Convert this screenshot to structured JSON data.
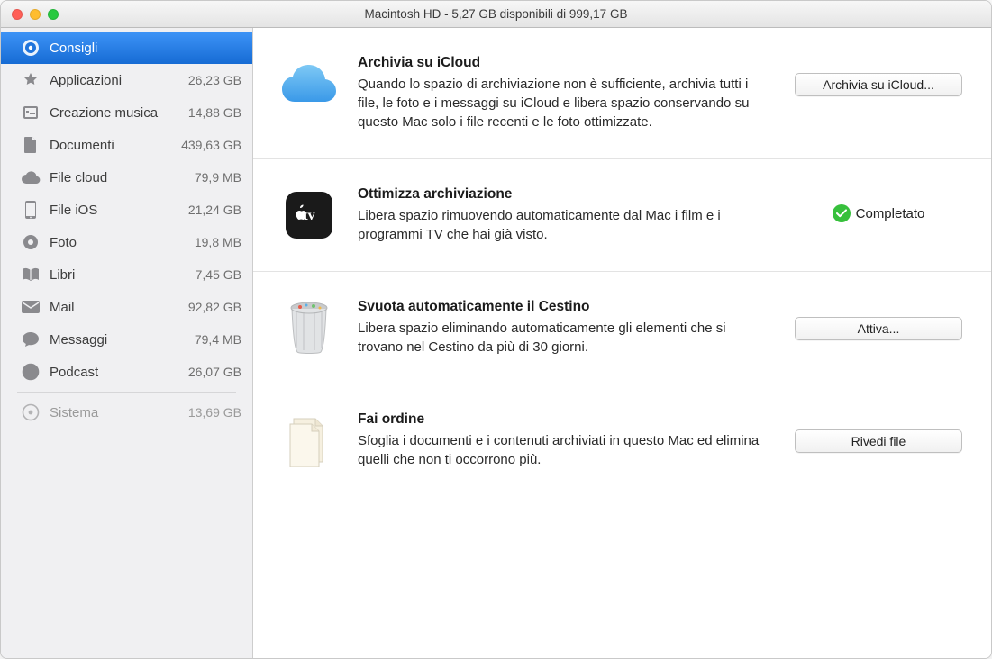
{
  "window": {
    "title": "Macintosh HD - 5,27 GB disponibili di 999,17 GB"
  },
  "sidebar": {
    "items": [
      {
        "label": "Consigli",
        "size": "",
        "icon": "tips"
      },
      {
        "label": "Applicazioni",
        "size": "26,23 GB",
        "icon": "apps"
      },
      {
        "label": "Creazione musica",
        "size": "14,88 GB",
        "icon": "music-creation"
      },
      {
        "label": "Documenti",
        "size": "439,63 GB",
        "icon": "documents"
      },
      {
        "label": "File cloud",
        "size": "79,9 MB",
        "icon": "cloud"
      },
      {
        "label": "File iOS",
        "size": "21,24 GB",
        "icon": "ios"
      },
      {
        "label": "Foto",
        "size": "19,8 MB",
        "icon": "photos"
      },
      {
        "label": "Libri",
        "size": "7,45 GB",
        "icon": "books"
      },
      {
        "label": "Mail",
        "size": "92,82 GB",
        "icon": "mail"
      },
      {
        "label": "Messaggi",
        "size": "79,4 MB",
        "icon": "messages"
      },
      {
        "label": "Podcast",
        "size": "26,07 GB",
        "icon": "podcast"
      }
    ],
    "systemItem": {
      "label": "Sistema",
      "size": "13,69 GB",
      "icon": "system"
    }
  },
  "recommendations": [
    {
      "key": "icloud",
      "title": "Archivia su iCloud",
      "desc": "Quando lo spazio di archiviazione non è sufficiente, archivia tutti i file, le foto e i messaggi su iCloud e libera spazio conservando su questo Mac solo i file recenti e le foto ottimizzate.",
      "action_type": "button",
      "action_label": "Archivia su iCloud..."
    },
    {
      "key": "optimize",
      "title": "Ottimizza archiviazione",
      "desc": "Libera spazio rimuovendo automaticamente dal Mac i film e i programmi TV che hai già visto.",
      "action_type": "completed",
      "action_label": "Completato"
    },
    {
      "key": "trash",
      "title": "Svuota automaticamente il Cestino",
      "desc": "Libera spazio eliminando automaticamente gli elementi che si trovano nel Cestino da più di 30 giorni.",
      "action_type": "button",
      "action_label": "Attiva..."
    },
    {
      "key": "reduce",
      "title": "Fai ordine",
      "desc": "Sfoglia i documenti e i contenuti archiviati in questo Mac ed elimina quelli che non ti occorrono più.",
      "action_type": "button",
      "action_label": "Rivedi file"
    }
  ]
}
